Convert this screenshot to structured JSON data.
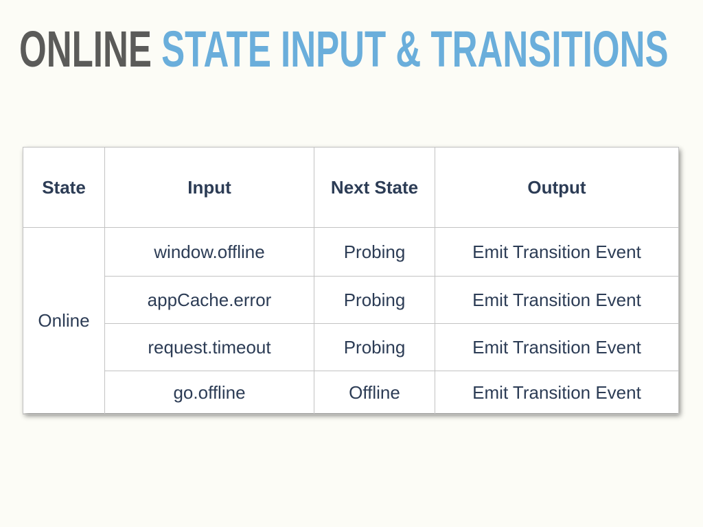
{
  "title": {
    "part1": "ONLINE",
    "part2": "STATE INPUT & TRANSITIONS"
  },
  "table": {
    "headers": [
      "State",
      "Input",
      "Next State",
      "Output"
    ],
    "state": "Online",
    "rows": [
      {
        "input": "window.offline",
        "next_state": "Probing",
        "output": "Emit Transition Event"
      },
      {
        "input": "appCache.error",
        "next_state": "Probing",
        "output": "Emit Transition Event"
      },
      {
        "input": "request.timeout",
        "next_state": "Probing",
        "output": "Emit Transition Event"
      },
      {
        "input": "go.offline",
        "next_state": "Offline",
        "output": "Emit Transition Event"
      }
    ]
  }
}
